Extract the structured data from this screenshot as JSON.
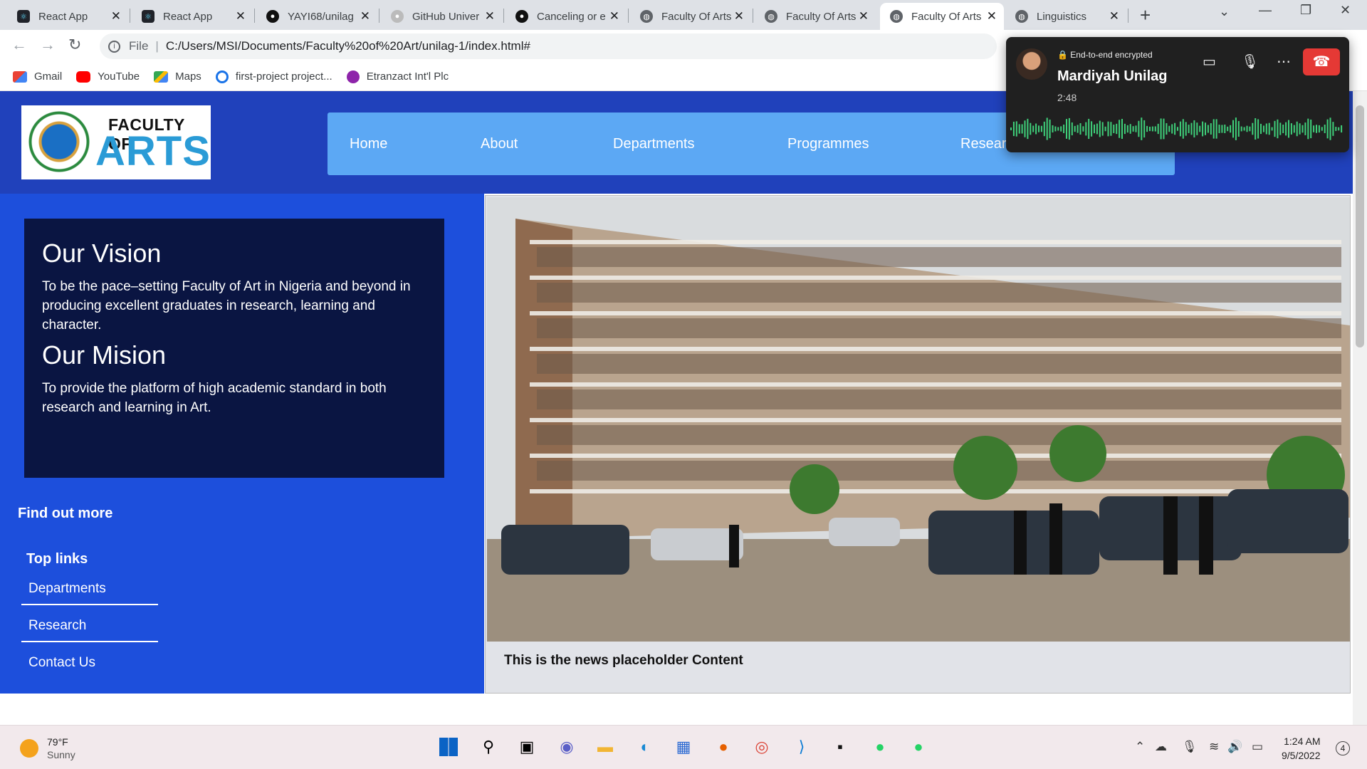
{
  "browser": {
    "tabs": [
      {
        "label": "React App",
        "icon": "react-icon"
      },
      {
        "label": "React App",
        "icon": "react-icon"
      },
      {
        "label": "YAYI68/unilag",
        "icon": "github-icon"
      },
      {
        "label": "GitHub Univer",
        "icon": "github-icon"
      },
      {
        "label": "Canceling or e",
        "icon": "github-icon"
      },
      {
        "label": "Faculty Of Arts",
        "icon": "globe-icon"
      },
      {
        "label": "Faculty Of Arts",
        "icon": "globe-icon"
      },
      {
        "label": "Faculty Of Arts",
        "icon": "globe-icon"
      },
      {
        "label": "Linguistics",
        "icon": "globe-icon"
      }
    ],
    "tab_close": "✕",
    "new_tab": "+",
    "url_scheme": "File",
    "url": "C:/Users/MSI/Documents/Faculty%20of%20Art/unilag-1/index.html#",
    "bookmarks": [
      {
        "label": "Gmail",
        "icon": "gmail-icon"
      },
      {
        "label": "YouTube",
        "icon": "youtube-icon"
      },
      {
        "label": "Maps",
        "icon": "maps-icon"
      },
      {
        "label": "first-project project...",
        "icon": "project-icon"
      },
      {
        "label": "Etranzact Int'l Plc",
        "icon": "etranzact-icon"
      }
    ]
  },
  "site": {
    "logo_line1": "FACULTY OF",
    "logo_line2": "ARTS",
    "nav": [
      "Home",
      "About",
      "Departments",
      "Programmes",
      "Research"
    ],
    "vision_title": "Our Vision",
    "vision_text": "To be the pace–setting Faculty of Art in Nigeria and beyond in producing excellent graduates in research, learning and character.",
    "mission_title": "Our Mision",
    "mission_text": "To provide the platform of high academic standard in both research and learning in Art.",
    "find_out_more": "Find out more",
    "top_links_title": "Top links",
    "top_links": [
      "Departments",
      "Research",
      "Contact Us"
    ],
    "news_caption": "This is the news placeholder Content",
    "colors": {
      "header": "#2041bb",
      "nav": "#5ca8f4",
      "panel": "#1d4fdc",
      "vision_box": "#0a1542"
    }
  },
  "call": {
    "encryption": "End-to-end encrypted",
    "caller": "Mardiyah Unilag",
    "duration": "2:48"
  },
  "taskbar": {
    "temperature": "79°F",
    "condition": "Sunny",
    "time": "1:24 AM",
    "date": "9/5/2022",
    "notifications": "4"
  }
}
